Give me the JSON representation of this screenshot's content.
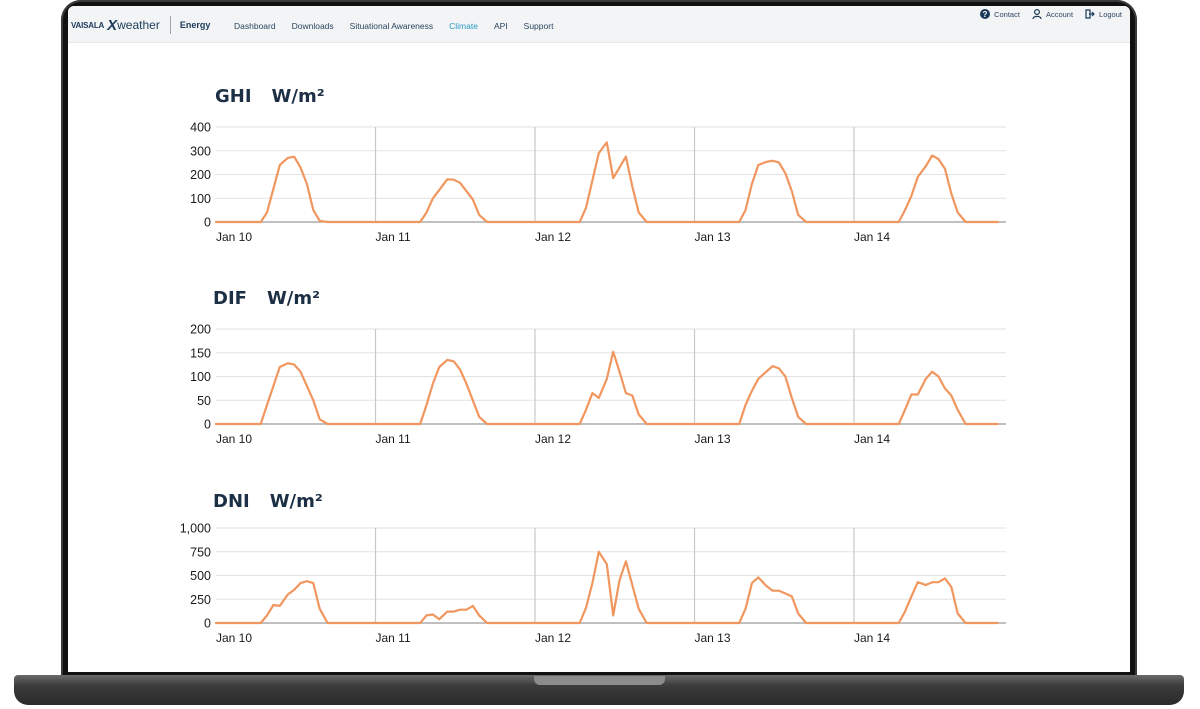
{
  "header": {
    "brand": {
      "vaisala": "VAISALA",
      "x": "X",
      "weather": "weather",
      "product": "Energy"
    },
    "nav": [
      "Dashboard",
      "Downloads",
      "Situational Awareness",
      "Climate",
      "API",
      "Support"
    ],
    "active_nav": "Climate",
    "utility": [
      {
        "label": "Contact",
        "icon": "question-circle-icon"
      },
      {
        "label": "Account",
        "icon": "user-icon"
      },
      {
        "label": "Logout",
        "icon": "logout-icon"
      }
    ]
  },
  "colors": {
    "series": "#f0965e",
    "grid": "#e2e2e2",
    "day_divider": "#c8c8c8",
    "nav_active": "#2b9bc4",
    "title": "#1c2f45"
  },
  "chart_data": [
    {
      "type": "line",
      "title": "GHI",
      "unit": "W/m²",
      "ylim": [
        0,
        400
      ],
      "yticks": [
        "0",
        "100",
        "200",
        "300",
        "400"
      ],
      "categories": [
        "Jan 10",
        "Jan 11",
        "Jan 12",
        "Jan 13",
        "Jan 14"
      ],
      "x_unit_note": "x in days from Jan 10 00:00",
      "grid": true,
      "series": [
        {
          "x": [
            0,
            0.28,
            0.32,
            0.36,
            0.4,
            0.45,
            0.49,
            0.53,
            0.57,
            0.61,
            0.65,
            0.7,
            1.0,
            1.28,
            1.32,
            1.36,
            1.4,
            1.45,
            1.49,
            1.53,
            1.57,
            1.61,
            1.65,
            1.7,
            2.0,
            2.28,
            2.32,
            2.4,
            2.45,
            2.49,
            2.53,
            2.57,
            2.61,
            2.65,
            2.7,
            3.0,
            3.28,
            3.32,
            3.36,
            3.4,
            3.45,
            3.49,
            3.53,
            3.57,
            3.61,
            3.65,
            3.7,
            4.0,
            4.28,
            4.32,
            4.36,
            4.4,
            4.45,
            4.49,
            4.53,
            4.57,
            4.61,
            4.65,
            4.7,
            4.9
          ],
          "y": [
            0,
            0,
            40,
            140,
            240,
            270,
            275,
            230,
            160,
            50,
            5,
            0,
            0,
            0,
            40,
            100,
            135,
            180,
            178,
            165,
            130,
            95,
            30,
            0,
            0,
            0,
            60,
            290,
            335,
            185,
            230,
            275,
            150,
            40,
            0,
            0,
            0,
            50,
            160,
            240,
            253,
            258,
            250,
            205,
            130,
            30,
            0,
            0,
            0,
            50,
            110,
            190,
            235,
            280,
            265,
            225,
            120,
            40,
            0,
            0
          ]
        }
      ]
    },
    {
      "type": "line",
      "title": "DIF",
      "unit": "W/m²",
      "ylim": [
        0,
        200
      ],
      "yticks": [
        "0",
        "50",
        "100",
        "150",
        "200"
      ],
      "categories": [
        "Jan 10",
        "Jan 11",
        "Jan 12",
        "Jan 13",
        "Jan 14"
      ],
      "grid": true,
      "series": [
        {
          "x": [
            0,
            0.28,
            0.32,
            0.36,
            0.4,
            0.45,
            0.49,
            0.53,
            0.57,
            0.61,
            0.65,
            0.7,
            1.0,
            1.28,
            1.32,
            1.36,
            1.4,
            1.45,
            1.49,
            1.53,
            1.57,
            1.61,
            1.65,
            1.7,
            2.0,
            2.28,
            2.32,
            2.36,
            2.4,
            2.45,
            2.49,
            2.53,
            2.57,
            2.61,
            2.65,
            2.7,
            3.0,
            3.28,
            3.32,
            3.36,
            3.4,
            3.45,
            3.49,
            3.53,
            3.57,
            3.61,
            3.65,
            3.7,
            4.0,
            4.28,
            4.32,
            4.36,
            4.4,
            4.45,
            4.49,
            4.53,
            4.57,
            4.61,
            4.65,
            4.7,
            4.9
          ],
          "y": [
            0,
            0,
            40,
            80,
            120,
            128,
            125,
            110,
            80,
            50,
            10,
            0,
            0,
            0,
            40,
            85,
            120,
            135,
            132,
            115,
            85,
            50,
            15,
            0,
            0,
            0,
            30,
            65,
            55,
            95,
            152,
            110,
            65,
            60,
            20,
            0,
            0,
            0,
            40,
            70,
            95,
            110,
            122,
            117,
            100,
            55,
            15,
            0,
            0,
            0,
            30,
            62,
            62,
            95,
            110,
            100,
            75,
            60,
            30,
            0,
            0
          ]
        }
      ]
    },
    {
      "type": "line",
      "title": "DNI",
      "unit": "W/m²",
      "ylim": [
        0,
        1000
      ],
      "yticks": [
        "0",
        "250",
        "500",
        "750",
        "1,000"
      ],
      "categories": [
        "Jan 10",
        "Jan 11",
        "Jan 12",
        "Jan 13",
        "Jan 14"
      ],
      "grid": true,
      "series": [
        {
          "x": [
            0,
            0.28,
            0.32,
            0.36,
            0.4,
            0.45,
            0.49,
            0.53,
            0.57,
            0.61,
            0.65,
            0.7,
            1.0,
            1.28,
            1.32,
            1.36,
            1.4,
            1.45,
            1.49,
            1.53,
            1.57,
            1.61,
            1.65,
            1.7,
            2.0,
            2.28,
            2.32,
            2.36,
            2.4,
            2.45,
            2.49,
            2.53,
            2.57,
            2.61,
            2.65,
            2.7,
            3.0,
            3.28,
            3.32,
            3.36,
            3.4,
            3.45,
            3.49,
            3.53,
            3.57,
            3.61,
            3.65,
            3.7,
            4.0,
            4.28,
            4.32,
            4.36,
            4.4,
            4.45,
            4.49,
            4.53,
            4.57,
            4.61,
            4.65,
            4.7,
            4.9
          ],
          "y": [
            0,
            0,
            80,
            190,
            180,
            300,
            350,
            420,
            440,
            420,
            150,
            0,
            0,
            0,
            80,
            90,
            40,
            120,
            120,
            140,
            140,
            180,
            80,
            0,
            0,
            0,
            160,
            420,
            750,
            620,
            80,
            450,
            650,
            400,
            150,
            0,
            0,
            0,
            150,
            420,
            480,
            390,
            340,
            340,
            310,
            280,
            100,
            0,
            0,
            0,
            120,
            280,
            430,
            400,
            430,
            430,
            470,
            380,
            100,
            0,
            0
          ]
        }
      ]
    }
  ]
}
